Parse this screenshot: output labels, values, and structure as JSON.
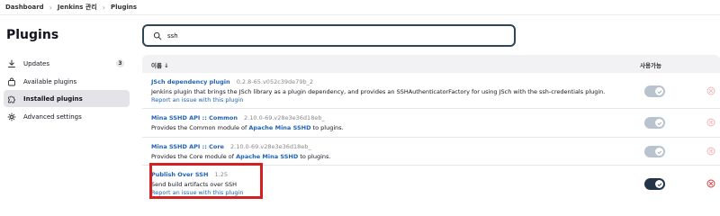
{
  "breadcrumb": [
    "Dashboard",
    "Jenkins 관리",
    "Plugins"
  ],
  "sidebar": {
    "title": "Plugins",
    "items": [
      {
        "label": "Updates",
        "badge": "3",
        "icon": "download-icon"
      },
      {
        "label": "Available plugins",
        "icon": "shopping-bag-icon"
      },
      {
        "label": "Installed plugins",
        "icon": "puzzle-icon",
        "active": true
      },
      {
        "label": "Advanced settings",
        "icon": "gear-icon"
      }
    ]
  },
  "search": {
    "value": "ssh",
    "icon": "search-icon"
  },
  "table": {
    "col_name": "이름 ↓",
    "col_enabled": "사용가능",
    "rows": [
      {
        "name": "JSch dependency plugin",
        "version": "0.2.8-65.v052c39de79b_2",
        "description": "Jenkins plugin that brings the JSch library as a plugin dependency, and provides an SSHAuthenticatorFactory for using JSch with the ssh-credentials plugin.",
        "issue_link": "Report an issue with this plugin",
        "enabled": true,
        "toggle_active": false,
        "delete_active": false
      },
      {
        "name": "Mina SSHD API :: Common",
        "version": "2.10.0-69.v28e3e36d18eb_",
        "desc_prefix": "Provides the Common module of ",
        "desc_link": "Apache Mina SSHD",
        "desc_suffix": " to plugins.",
        "enabled": true,
        "toggle_active": false,
        "delete_active": false
      },
      {
        "name": "Mina SSHD API :: Core",
        "version": "2.10.0-69.v28e3e36d18eb_",
        "desc_prefix": "Provides the Core module of ",
        "desc_link": "Apache Mina SSHD",
        "desc_suffix": " to plugins.",
        "enabled": true,
        "toggle_active": false,
        "delete_active": false
      },
      {
        "name": "Publish Over SSH",
        "version": "1.25",
        "description": "Send build artifacts over SSH",
        "issue_link": "Report an issue with this plugin",
        "enabled": true,
        "toggle_active": true,
        "delete_active": true
      }
    ]
  },
  "colors": {
    "link": "#1e62b8",
    "toggle_on": "#223548",
    "toggle_disabled": "#b9c3cd",
    "delete_active": "#d32f2f",
    "delete_inactive": "#f2b3b3",
    "highlight": "#d42020"
  }
}
